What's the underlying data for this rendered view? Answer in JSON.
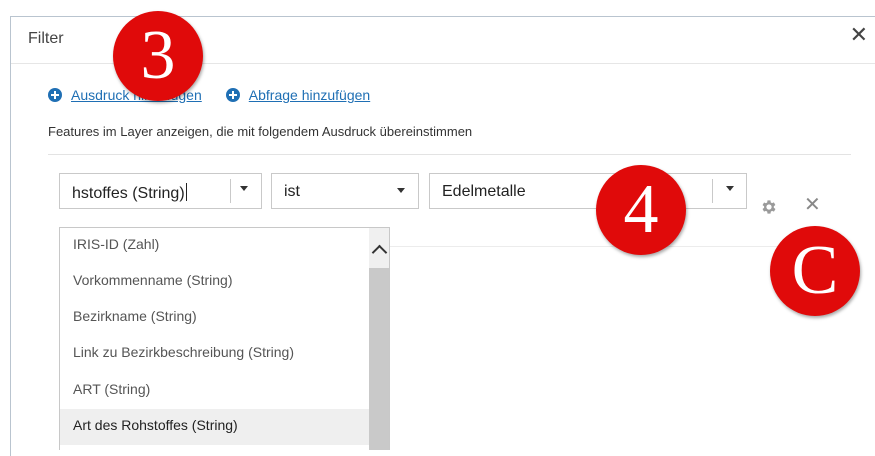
{
  "dialog": {
    "title": "Filter",
    "close_icon": "close-icon"
  },
  "actions": {
    "add_expression": "Ausdruck hinzufügen",
    "add_query": "Abfrage hinzufügen",
    "icon": "plus-circle-icon"
  },
  "description": "Features im Layer anzeigen, die mit folgendem Ausdruck übereinstimmen",
  "expression": {
    "field_value": "hstoffes (String)",
    "operator_value": "ist",
    "value_value": "Edelmetalle",
    "settings_icon": "gear-icon",
    "delete_icon": "close-icon"
  },
  "dropdown": {
    "items": [
      "IRIS-ID (Zahl)",
      "Vorkommenname (String)",
      "Bezirkname (String)",
      "Link zu Bezirkbeschreibung (String)",
      "ART (String)",
      "Art des Rohstoffes (String)"
    ],
    "selected_index": 5
  },
  "badges": {
    "b3": "3",
    "b4": "4",
    "bc": "C",
    "color": "#e00a0a"
  },
  "colors": {
    "link": "#1f6fb4"
  }
}
